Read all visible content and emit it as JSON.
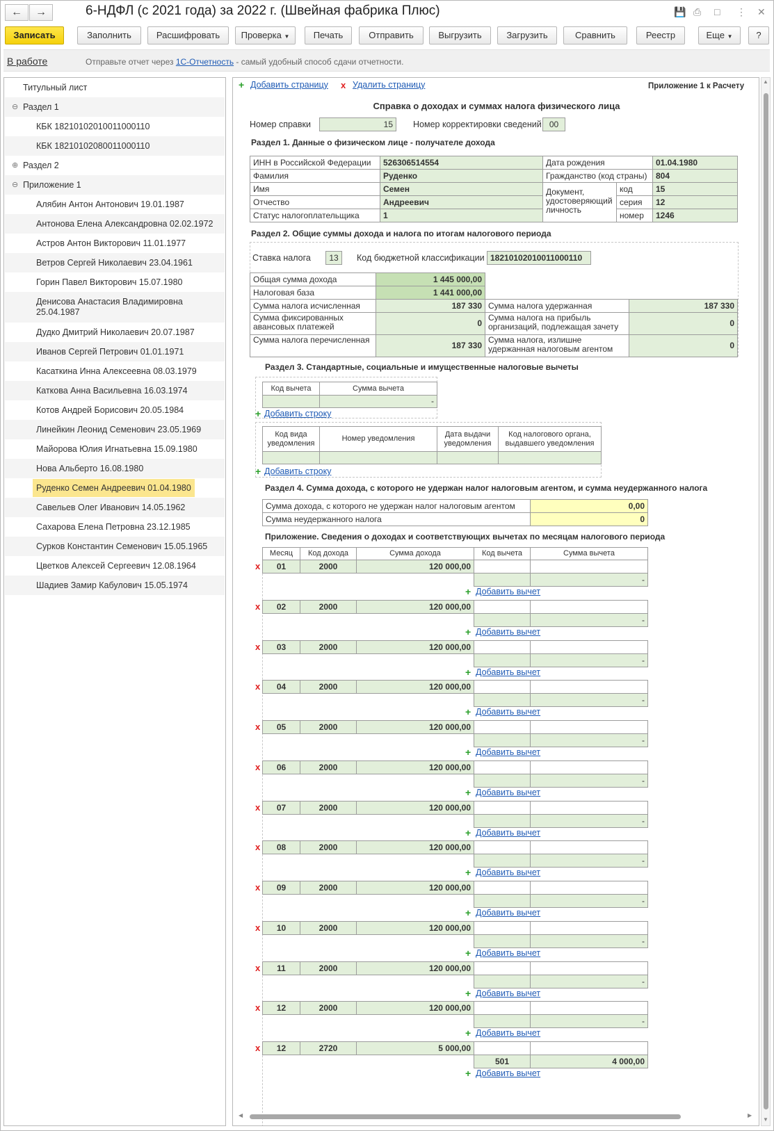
{
  "window": {
    "title": "6-НДФЛ (с 2021 года) за 2022 г. (Швейная фабрика Плюс)",
    "back_icon": "arrow-left-icon",
    "forward_icon": "arrow-right-icon"
  },
  "toolbar": {
    "save": "Записать",
    "fill": "Заполнить",
    "decode": "Расшифровать",
    "check": "Проверка",
    "print": "Печать",
    "send": "Отправить",
    "export": "Выгрузить",
    "load": "Загрузить",
    "compare": "Сравнить",
    "registry": "Реестр",
    "more": "Еще",
    "help": "?"
  },
  "infobar": {
    "status": "В работе",
    "hint_prefix": "Отправьте отчет через ",
    "hint_link": "1С-Отчетность",
    "hint_suffix": " - самый удобный способ сдачи отчетности."
  },
  "tree": [
    {
      "label": "Титульный лист",
      "level": 0
    },
    {
      "label": "Раздел 1",
      "level": 0,
      "expander": "⊖"
    },
    {
      "label": "КБК 18210102010011000110",
      "level": 1
    },
    {
      "label": "КБК 18210102080011000110",
      "level": 1
    },
    {
      "label": "Раздел 2",
      "level": 0,
      "expander": "⊕"
    },
    {
      "label": "Приложение 1",
      "level": 0,
      "expander": "⊖"
    },
    {
      "label": "Алябин Антон Антонович 19.01.1987",
      "level": 1
    },
    {
      "label": "Антонова Елена Александровна 02.02.1972",
      "level": 1
    },
    {
      "label": "Астров Антон Викторович 11.01.1977",
      "level": 1
    },
    {
      "label": "Ветров Сергей Николаевич 23.04.1961",
      "level": 1
    },
    {
      "label": "Горин Павел Викторович 15.07.1980",
      "level": 1
    },
    {
      "label": "Денисова Анастасия Владимировна 25.04.1987",
      "level": 1,
      "two_line": true
    },
    {
      "label": "Дудко Дмитрий Николаевич 20.07.1987",
      "level": 1
    },
    {
      "label": "Иванов Сергей Петрович 01.01.1971",
      "level": 1
    },
    {
      "label": "Касаткина Инна Алексеевна 08.03.1979",
      "level": 1
    },
    {
      "label": "Каткова Анна Васильевна 16.03.1974",
      "level": 1
    },
    {
      "label": "Котов Андрей Борисович 20.05.1984",
      "level": 1
    },
    {
      "label": "Линейкин Леонид Семенович 23.05.1969",
      "level": 1
    },
    {
      "label": "Майорова Юлия Игнатьевна 15.09.1980",
      "level": 1
    },
    {
      "label": "Нова Альберто 16.08.1980",
      "level": 1
    },
    {
      "label": "Руденко Семен Андреевич 01.04.1980",
      "level": 1,
      "selected": true
    },
    {
      "label": "Савельев Олег Иванович 14.05.1962",
      "level": 1
    },
    {
      "label": "Сахарова Елена Петровна 23.12.1985",
      "level": 1
    },
    {
      "label": "Сурков Константин Семенович 15.05.1965",
      "level": 1
    },
    {
      "label": "Цветков Алексей Сергеевич 12.08.1964",
      "level": 1
    },
    {
      "label": "Шадиев Замир Кабулович 15.05.1974",
      "level": 1
    }
  ],
  "form": {
    "add_page": "Добавить страницу",
    "delete_page": "Удалить страницу",
    "appendix_ref": "Приложение 1 к Расчету",
    "title": "Справка о доходах и суммах налога физического лица",
    "cert_no_label": "Номер справки",
    "cert_no": "15",
    "corr_label": "Номер корректировки сведений",
    "corr": "00",
    "s1": {
      "title": "Раздел 1. Данные о физическом лице - получателе дохода",
      "inn_label": "ИНН в Российской Федерации",
      "inn": "526306514554",
      "surname_label": "Фамилия",
      "surname": "Руденко",
      "name_label": "Имя",
      "name": "Семен",
      "patronymic_label": "Отчество",
      "patronymic": "Андреевич",
      "status_label": "Статус налогоплательщика",
      "status": "1",
      "birth_label": "Дата рождения",
      "birth": "01.04.1980",
      "citizenship_label": "Гражданство (код страны)",
      "citizenship": "804",
      "doc_label": "Документ, удостоверяющий личность",
      "doc_code_label": "код",
      "doc_code": "15",
      "doc_series_label": "серия",
      "doc_series": "12",
      "doc_number_label": "номер",
      "doc_number": "1246"
    },
    "s2": {
      "title": "Раздел 2. Общие суммы дохода и налога по итогам налогового периода",
      "rate_label": "Ставка налога",
      "rate": "13",
      "kbk_label": "Код бюджетной классификации",
      "kbk": "18210102010011000110",
      "income_label": "Общая сумма дохода",
      "income": "1 445 000,00",
      "base_label": "Налоговая база",
      "base": "1 441 000,00",
      "calc_label": "Сумма налога исчисленная",
      "calc": "187 330",
      "fixed_label": "Сумма фиксированных авансовых платежей",
      "fixed": "0",
      "transferred_label": "Сумма налога перечисленная",
      "transferred": "187 330",
      "withheld_label": "Сумма налога удержанная",
      "withheld": "187 330",
      "profit_label": "Сумма налога на прибыль организаций, подлежащая зачету",
      "profit": "0",
      "excess_label": "Сумма налога, излишне удержанная налоговым агентом",
      "excess": "0"
    },
    "s3": {
      "title": "Раздел 3. Стандартные, социальные и имущественные налоговые вычеты",
      "col_code": "Код вычета",
      "col_sum": "Сумма вычета",
      "row_sum": "-",
      "add_row": "Добавить строку",
      "notif_cols": [
        "Код вида уведомления",
        "Номер уведомления",
        "Дата выдачи уведомления",
        "Код налогового органа, выдавшего уведомления"
      ],
      "add_row2": "Добавить строку"
    },
    "s4": {
      "title": "Раздел 4. Сумма дохода, с которого не удержан налог налоговым агентом, и сумма неудержанного налога",
      "not_withheld_income_label": "Сумма дохода, с которого не удержан налог налоговым агентом",
      "not_withheld_income": "0,00",
      "not_withheld_tax_label": "Сумма неудержанного налога",
      "not_withheld_tax": "0"
    },
    "appendix": {
      "title": "Приложение. Сведения о доходах и соответствующих вычетах по месяцам налогового периода",
      "cols": [
        "Месяц",
        "Код дохода",
        "Сумма дохода",
        "Код вычета",
        "Сумма вычета"
      ],
      "add_deduction": "Добавить вычет",
      "rows": [
        {
          "month": "01",
          "code": "2000",
          "sum": "120 000,00",
          "d_code": "",
          "d_sum": "-"
        },
        {
          "month": "02",
          "code": "2000",
          "sum": "120 000,00",
          "d_code": "",
          "d_sum": "-"
        },
        {
          "month": "03",
          "code": "2000",
          "sum": "120 000,00",
          "d_code": "",
          "d_sum": "-"
        },
        {
          "month": "04",
          "code": "2000",
          "sum": "120 000,00",
          "d_code": "",
          "d_sum": "-"
        },
        {
          "month": "05",
          "code": "2000",
          "sum": "120 000,00",
          "d_code": "",
          "d_sum": "-"
        },
        {
          "month": "06",
          "code": "2000",
          "sum": "120 000,00",
          "d_code": "",
          "d_sum": "-"
        },
        {
          "month": "07",
          "code": "2000",
          "sum": "120 000,00",
          "d_code": "",
          "d_sum": "-"
        },
        {
          "month": "08",
          "code": "2000",
          "sum": "120 000,00",
          "d_code": "",
          "d_sum": "-"
        },
        {
          "month": "09",
          "code": "2000",
          "sum": "120 000,00",
          "d_code": "",
          "d_sum": "-"
        },
        {
          "month": "10",
          "code": "2000",
          "sum": "120 000,00",
          "d_code": "",
          "d_sum": "-"
        },
        {
          "month": "11",
          "code": "2000",
          "sum": "120 000,00",
          "d_code": "",
          "d_sum": "-"
        },
        {
          "month": "12",
          "code": "2000",
          "sum": "120 000,00",
          "d_code": "",
          "d_sum": "-"
        },
        {
          "month": "12",
          "code": "2720",
          "sum": "5 000,00",
          "d_code": "501",
          "d_sum": "4 000,00"
        }
      ]
    }
  },
  "colors": {
    "accent_yellow": "#f5d10c",
    "field_green": "#e2efda",
    "field_yellow": "#ffffbe",
    "link": "#1f5bb5",
    "add_green": "#2aa02a",
    "delete_red": "#e02020"
  }
}
